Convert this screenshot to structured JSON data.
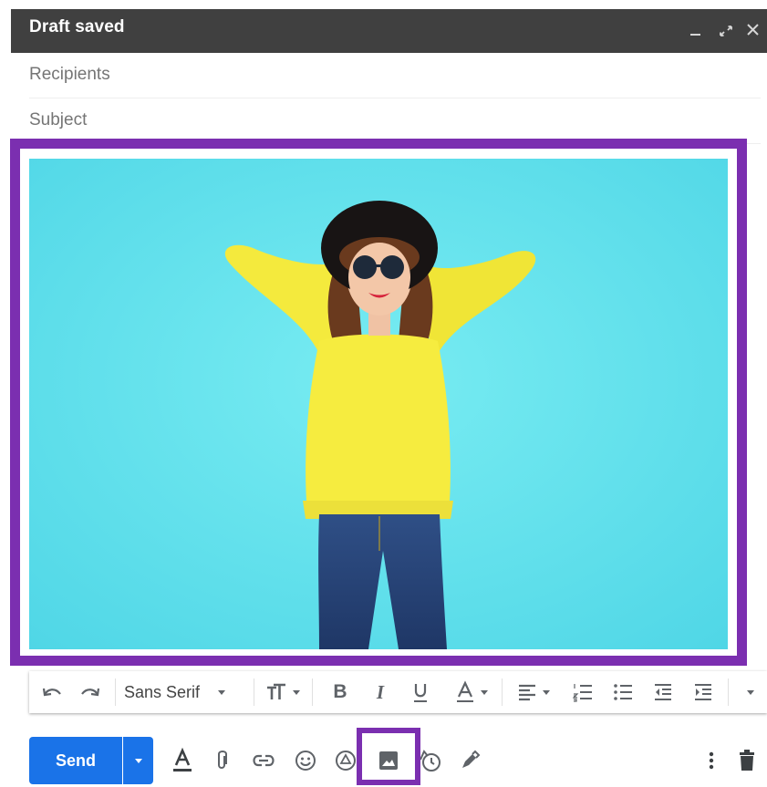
{
  "compose": {
    "status": "Draft saved",
    "recipients_placeholder": "Recipients",
    "subject_placeholder": "Subject"
  },
  "toolbar": {
    "font_name": "Sans Serif",
    "items": [
      "undo-icon",
      "redo-icon",
      "font-family-select",
      "font-size-icon",
      "bold-icon",
      "italic-icon",
      "underline-icon",
      "text-color-icon",
      "align-icon",
      "numbered-list-icon",
      "bulleted-list-icon",
      "indent-less-icon",
      "indent-more-icon",
      "more-formatting-icon"
    ]
  },
  "bottom": {
    "send_label": "Send",
    "icons": [
      "formatting-options-icon",
      "attach-icon",
      "link-icon",
      "emoji-icon",
      "drive-icon",
      "insert-photo-icon",
      "schedule-icon",
      "signature-icon",
      "more-options-icon",
      "discard-icon"
    ]
  },
  "colors": {
    "titlebar": "#404040",
    "highlight": "#7b2fb0",
    "send": "#1a73e8",
    "photo_bg": "#5fdde9"
  }
}
